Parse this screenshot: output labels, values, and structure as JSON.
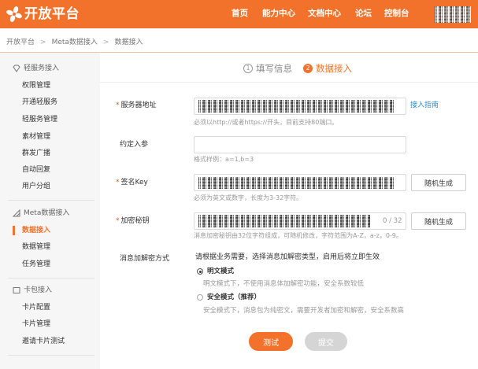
{
  "header": {
    "logo_text": "开放平台",
    "logo_icon": "flower-logo-icon",
    "nav": [
      "首页",
      "能力中心",
      "文档中心",
      "论坛",
      "控制台"
    ]
  },
  "breadcrumb": {
    "items": [
      "开放平台",
      "Meta数据接入",
      "数据接入"
    ],
    "separator": ">"
  },
  "sidebar": {
    "sections": [
      {
        "title": "轻服务接入",
        "icon": "diamond-icon",
        "items": [
          {
            "label": "权限管理",
            "active": false
          },
          {
            "label": "开通轻服务",
            "active": false
          },
          {
            "label": "轻服务管理",
            "active": false
          },
          {
            "label": "素材管理",
            "active": false
          },
          {
            "label": "群发广播",
            "active": false
          },
          {
            "label": "自动回复",
            "active": false
          },
          {
            "label": "用户分组",
            "active": false
          }
        ]
      },
      {
        "title": "Meta数据接入",
        "icon": "triangle-icon",
        "items": [
          {
            "label": "数据接入",
            "active": true
          },
          {
            "label": "数据管理",
            "active": false
          },
          {
            "label": "任务管理",
            "active": false
          }
        ]
      },
      {
        "title": "卡包接入",
        "icon": "card-icon",
        "items": [
          {
            "label": "卡片配置",
            "active": false
          },
          {
            "label": "卡片管理",
            "active": false
          },
          {
            "label": "邀请卡片测试",
            "active": false
          }
        ]
      }
    ]
  },
  "steps": [
    {
      "number": "1",
      "label": "填写信息",
      "active": false
    },
    {
      "number": "2",
      "label": "数据接入",
      "active": true
    }
  ],
  "form": {
    "required_mark": "*",
    "server_address": {
      "label": "服务器地址",
      "required": true,
      "hint": "必须以http://或者https://开头，目前支持80端口。",
      "guide_link": "接入指南"
    },
    "params": {
      "label": "约定入参",
      "required": false,
      "value": "",
      "hint": "格式样例：a=1,b=3"
    },
    "sign_key": {
      "label": "签名Key",
      "required": true,
      "hint": "必须为英文或数字，长度为3-32字符。",
      "button": "随机生成"
    },
    "encrypt_key": {
      "label": "加密秘钥",
      "required": true,
      "hint": "消息加密秘钥由32位字符组成，可随机修改，字符范围为A-Z，a-z，0-9。",
      "button": "随机生成",
      "counter": "0 / 32"
    },
    "encryption_mode": {
      "label": "消息加解密方式",
      "intro": "请根据业务需要，选择消息加解密类型，启用后将立即生效",
      "options": [
        {
          "label": "明文模式",
          "description": "明文模式下，不使用消息体加解密功能，安全系数较低",
          "checked": true
        },
        {
          "label": "安全模式（推荐）",
          "description": "安全模式下，消息包为纯密文，需要开发者加密和解密，安全系数高",
          "checked": false
        }
      ]
    }
  },
  "actions": {
    "test_label": "测试",
    "submit_label": "提交",
    "submit_enabled": false
  },
  "colors": {
    "brand": "#f2722c",
    "link": "#2d8cd8",
    "button_disabled": "#d5d5d5",
    "sidebar_bg": "#f6f6f6"
  }
}
